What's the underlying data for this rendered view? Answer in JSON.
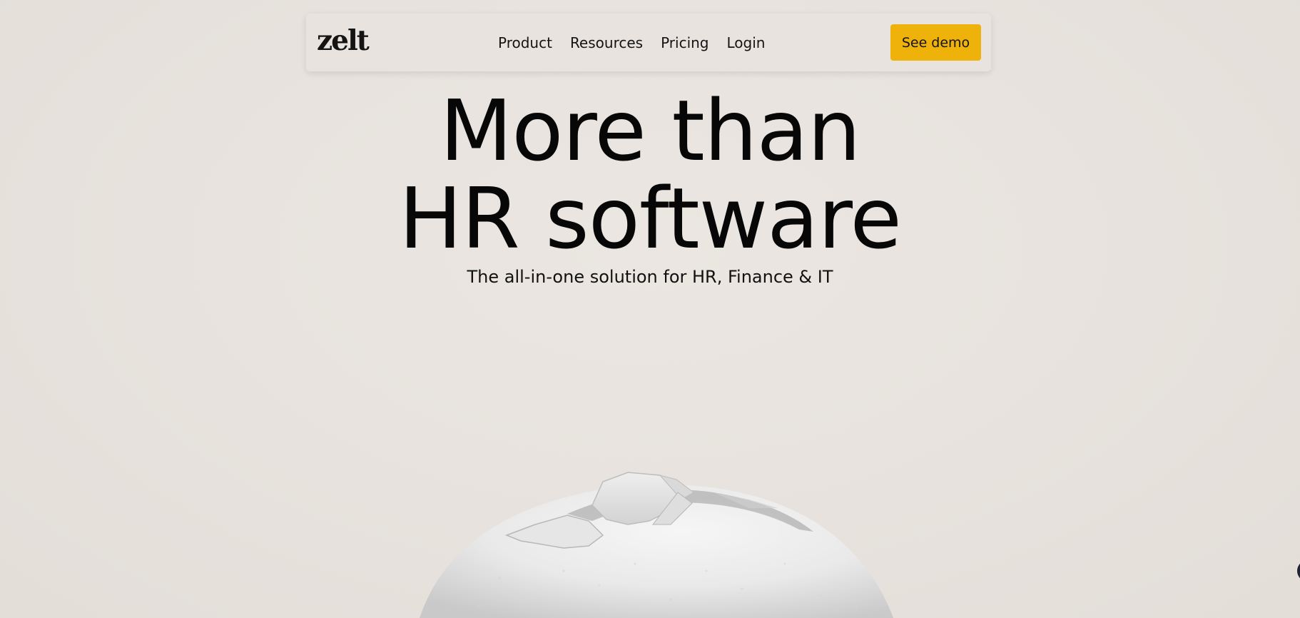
{
  "header": {
    "logo_text": "zelt",
    "nav": [
      {
        "label": "Product"
      },
      {
        "label": "Resources"
      },
      {
        "label": "Pricing"
      },
      {
        "label": "Login"
      }
    ],
    "cta_label": "See demo"
  },
  "hero": {
    "title_line1": "More than",
    "title_line2": "HR software",
    "subtitle": "The all-in-one solution for HR, Finance & IT"
  },
  "colors": {
    "accent": "#efb20b",
    "background": "#e8e3de",
    "text": "#0d0d0d"
  },
  "icons": {
    "hero_image": "cracked-sphere-image",
    "chat": "chat-launcher-icon"
  }
}
